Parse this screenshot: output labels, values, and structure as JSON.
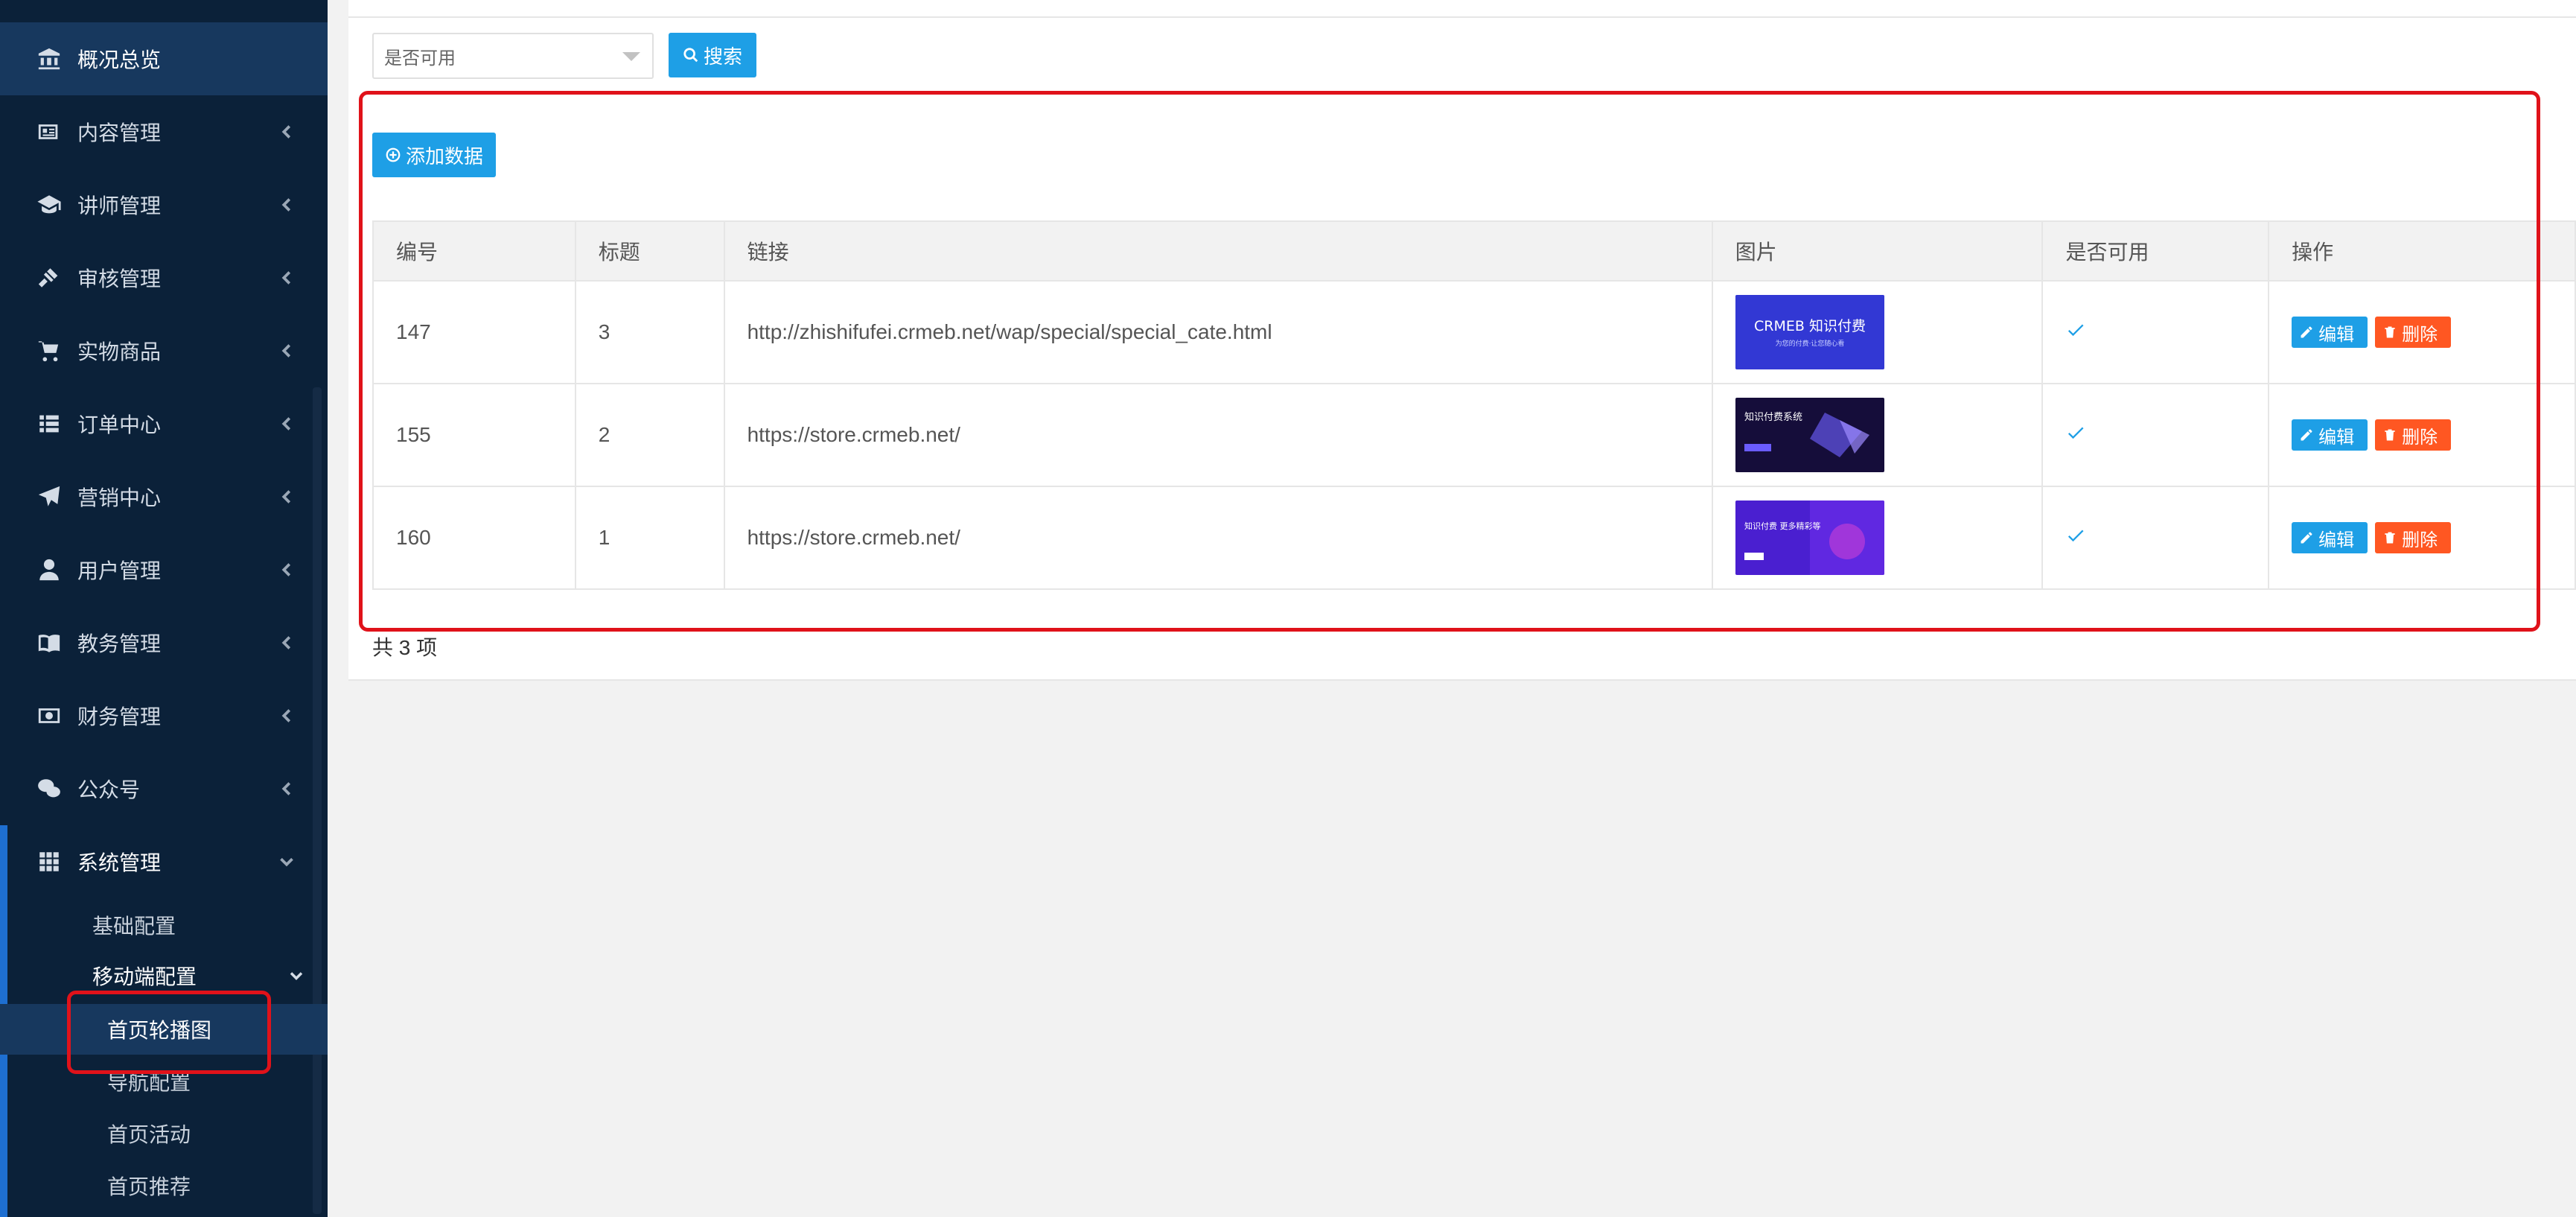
{
  "sidebar": {
    "items": [
      {
        "label": "概况总览",
        "icon": "bank-icon"
      },
      {
        "label": "内容管理",
        "icon": "newspaper-icon"
      },
      {
        "label": "讲师管理",
        "icon": "graduation-cap-icon"
      },
      {
        "label": "审核管理",
        "icon": "gavel-icon"
      },
      {
        "label": "实物商品",
        "icon": "cart-icon"
      },
      {
        "label": "订单中心",
        "icon": "list-icon"
      },
      {
        "label": "营销中心",
        "icon": "paper-plane-icon"
      },
      {
        "label": "用户管理",
        "icon": "user-icon"
      },
      {
        "label": "教务管理",
        "icon": "book-icon"
      },
      {
        "label": "财务管理",
        "icon": "money-icon"
      },
      {
        "label": "公众号",
        "icon": "wechat-icon"
      },
      {
        "label": "系统管理",
        "icon": "grid-icon"
      }
    ],
    "sub": {
      "basic_config": "基础配置",
      "mobile_config": "移动端配置",
      "mobile_children": [
        "首页轮播图",
        "导航配置",
        "首页活动",
        "首页推荐"
      ]
    }
  },
  "filter": {
    "select_value": "是否可用",
    "search_label": "搜索"
  },
  "toolbar": {
    "add_label": "添加数据"
  },
  "table": {
    "headers": [
      "编号",
      "标题",
      "链接",
      "图片",
      "是否可用",
      "操作"
    ],
    "rows": [
      {
        "id": "147",
        "title": "3",
        "link": "http://zhishifufei.crmeb.net/wap/special/special_cate.html",
        "image_text": "CRMEB 知识付费",
        "image_subtext": "为您的付费·让您随心看"
      },
      {
        "id": "155",
        "title": "2",
        "link": "https://store.crmeb.net/",
        "image_text": "知识付费系统"
      },
      {
        "id": "160",
        "title": "1",
        "link": "https://store.crmeb.net/",
        "image_text": "知识付费 更多精彩等"
      }
    ],
    "edit_label": "编辑",
    "delete_label": "删除",
    "total": "共 3 项"
  },
  "colors": {
    "sidebar_bg": "#0b2139",
    "sidebar_active": "#17385e",
    "primary": "#1e9fe6",
    "danger": "#ff5722",
    "highlight": "#e0121a"
  }
}
